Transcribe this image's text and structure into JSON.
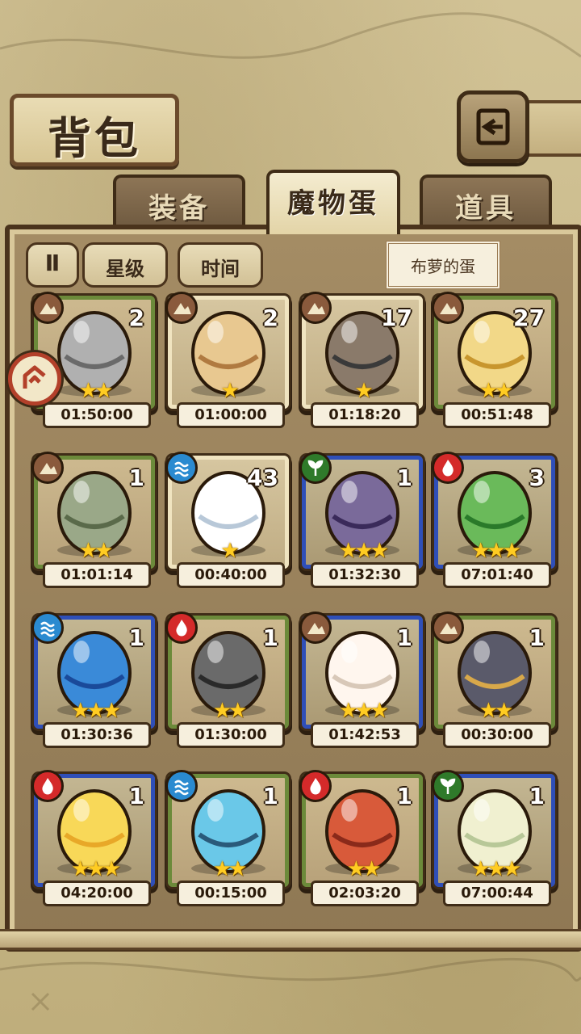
{
  "header": {
    "title": "背包"
  },
  "tabs": [
    {
      "label": "装备",
      "active": false
    },
    {
      "label": "魔物蛋",
      "active": true
    },
    {
      "label": "道具",
      "active": false
    }
  ],
  "controls": {
    "sort_toggle_label": "Ⅱ",
    "sort_star_label": "星级",
    "sort_time_label": "时间",
    "tooltip_text": "布萝的蛋"
  },
  "colors": {
    "earth": "#8a5a3c",
    "water": "#2a8ad0",
    "fire": "#d42a2a",
    "grass": "#2f7a2a",
    "frame_green": "#6c8a3a",
    "frame_blue": "#2f4fb8",
    "frame_cream": "#f0e4c0"
  },
  "eggs": [
    {
      "element": "earth",
      "frame": "green",
      "count": "2",
      "stars": "★★",
      "timer": "01:50:00",
      "icon": "gray-feather-egg-icon"
    },
    {
      "element": "earth",
      "frame": "cream",
      "count": "2",
      "stars": "★",
      "timer": "01:00:00",
      "icon": "spotted-egg-icon"
    },
    {
      "element": "earth",
      "frame": "cream",
      "count": "17",
      "stars": "★",
      "timer": "01:18:20",
      "icon": "mushroom-egg-icon"
    },
    {
      "element": "earth",
      "frame": "green",
      "count": "27",
      "stars": "★★",
      "timer": "00:51:48",
      "icon": "swirl-egg-icon"
    },
    {
      "element": "earth",
      "frame": "green",
      "count": "1",
      "stars": "★★",
      "timer": "01:01:14",
      "icon": "leaf-egg-icon"
    },
    {
      "element": "water",
      "frame": "cream",
      "count": "43",
      "stars": "★",
      "timer": "00:40:00",
      "icon": "white-egg-icon"
    },
    {
      "element": "grass",
      "frame": "blue",
      "count": "1",
      "stars": "★★★",
      "timer": "01:32:30",
      "icon": "purple-egg-icon"
    },
    {
      "element": "fire",
      "frame": "blue",
      "count": "3",
      "stars": "★★★",
      "timer": "07:01:40",
      "icon": "cactus-egg-icon"
    },
    {
      "element": "water",
      "frame": "blue",
      "count": "1",
      "stars": "★★★",
      "timer": "01:30:36",
      "icon": "eye-drop-egg-icon"
    },
    {
      "element": "fire",
      "frame": "green",
      "count": "1",
      "stars": "★★",
      "timer": "01:30:00",
      "icon": "rock-egg-icon"
    },
    {
      "element": "earth",
      "frame": "blue",
      "count": "1",
      "stars": "★★★",
      "timer": "01:42:53",
      "icon": "fluffy-egg-icon"
    },
    {
      "element": "earth",
      "frame": "green",
      "count": "1",
      "stars": "★★",
      "timer": "00:30:00",
      "icon": "hat-egg-icon"
    },
    {
      "element": "fire",
      "frame": "blue",
      "count": "1",
      "stars": "★★★",
      "timer": "04:20:00",
      "icon": "sun-egg-icon"
    },
    {
      "element": "water",
      "frame": "green",
      "count": "1",
      "stars": "★★",
      "timer": "00:15:00",
      "icon": "shell-egg-icon"
    },
    {
      "element": "fire",
      "frame": "green",
      "count": "1",
      "stars": "★★",
      "timer": "02:03:20",
      "icon": "lava-egg-icon"
    },
    {
      "element": "grass",
      "frame": "blue",
      "count": "1",
      "stars": "★★★",
      "timer": "07:00:44",
      "icon": "bud-egg-icon"
    }
  ]
}
